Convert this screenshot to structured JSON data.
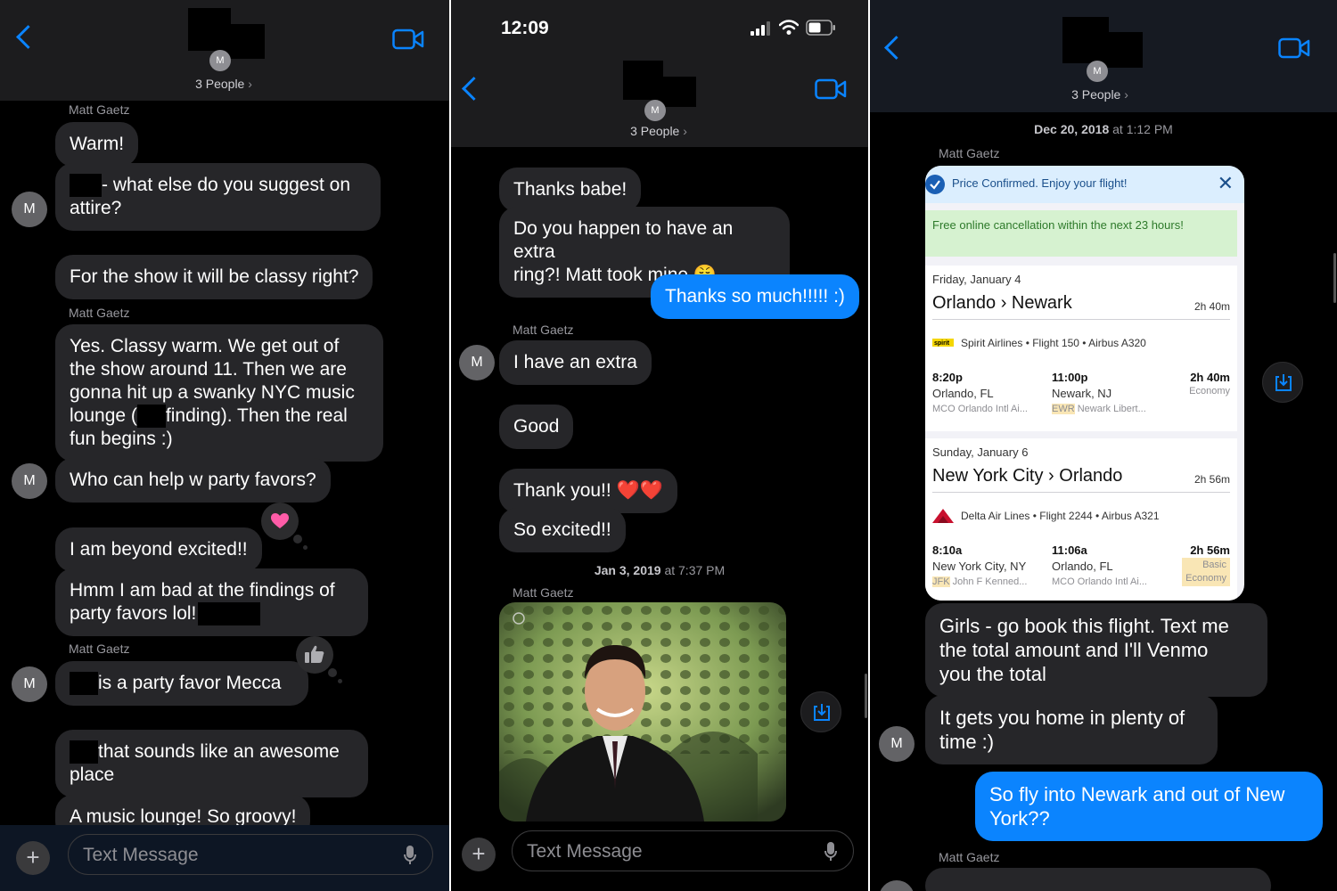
{
  "panel1": {
    "header": {
      "avatar_initial": "M",
      "group_label": "3 People",
      "chevron": "›"
    },
    "messages": [
      {
        "sender": "Matt Gaetz"
      },
      {
        "text": "Warm!"
      },
      {
        "text_after_redaction": "- what else do you suggest on",
        "text_line2": "attire?"
      },
      {
        "text": "For the show it will be classy right?"
      },
      {
        "sender": "Matt Gaetz"
      },
      {
        "lines": [
          "Yes. Classy warm. We get out of",
          "the show around 11. Then we are",
          "gonna hit up a swanky NYC music"
        ],
        "line4_before": "lounge (",
        "line4_after": "finding). Then the real",
        "line5": "fun begins :)"
      },
      {
        "text": "Who can help w party favors?"
      },
      {
        "text": "I am beyond excited!!",
        "tapback": "heart"
      },
      {
        "line1": "Hmm I am bad at the findings of",
        "line2": "party favors lol!"
      },
      {
        "sender": "Matt Gaetz"
      },
      {
        "text_after_redaction": "is a party favor Mecca",
        "tapback": "thumbs-up"
      },
      {
        "text_after_redaction": "that sounds like an awesome",
        "text_line2": "place"
      },
      {
        "text": "A music lounge! So groovy!"
      }
    ],
    "avatar_initial": "M",
    "compose": {
      "placeholder": "Text Message",
      "plus": "+"
    }
  },
  "panel2": {
    "status": {
      "time": "12:09"
    },
    "header": {
      "avatar_initial": "M",
      "group_label": "3 People",
      "chevron": "›"
    },
    "messages": [
      {
        "text": "Thanks babe!"
      },
      {
        "line1": "Do you happen to have an extra",
        "line2": "ring?! Matt took mine 😤"
      },
      {
        "text": "Thanks so much!!!!! :)"
      },
      {
        "sender": "Matt Gaetz"
      },
      {
        "text": "I have an extra"
      },
      {
        "text": "Good"
      },
      {
        "text": "Thank you!! ❤️❤️"
      },
      {
        "text": "So excited!!"
      },
      {
        "sender": "Matt Gaetz"
      }
    ],
    "timestamp": {
      "date": "Jan 3, 2019",
      "time": "at 7:37 PM"
    },
    "avatar_initial": "M",
    "compose": {
      "placeholder": "Text Message",
      "plus": "+"
    }
  },
  "panel3": {
    "header": {
      "avatar_initial": "M",
      "group_label": "3 People",
      "chevron": "›"
    },
    "timestamp": {
      "date": "Dec 20, 2018",
      "time": "at 1:12 PM"
    },
    "sender": "Matt Gaetz",
    "sender_bottom": "Matt Gaetz",
    "card": {
      "banner": "Price Confirmed. Enjoy your flight!",
      "close": "✕",
      "cancellation": "Free online cancellation within the next 23 hours!",
      "seg1": {
        "date": "Friday, January 4",
        "route": "Orlando › Newark",
        "duration": "2h 40m",
        "airline_logo": "spirit",
        "airline": "Spirit Airlines • Flight 150 • Airbus A320",
        "depart_time": "8:20p",
        "depart_city": "Orlando, FL",
        "depart_airport": "MCO Orlando Intl Ai...",
        "arrive_time": "11:00p",
        "arrive_city": "Newark, NJ",
        "arrive_code": "EWR",
        "arrive_airport": "Newark Libert...",
        "total": "2h 40m",
        "class": "Economy"
      },
      "seg2": {
        "date": "Sunday, January 6",
        "route": "New York City › Orlando",
        "duration": "2h 56m",
        "airline": "Delta Air Lines • Flight 2244 • Airbus A321",
        "depart_time": "8:10a",
        "depart_city": "New York City, NY",
        "depart_code": "JFK",
        "depart_airport": "John F Kenned...",
        "arrive_time": "11:06a",
        "arrive_city": "Orlando, FL",
        "arrive_airport": "MCO Orlando Intl Ai...",
        "total": "2h 56m",
        "class_line1": "Basic",
        "class_line2": "Economy"
      }
    },
    "messages": [
      {
        "lines": [
          "Girls - go book this flight. Text me",
          "the total amount and I'll Venmo",
          "you the total"
        ]
      },
      {
        "line1": "It gets you home in plenty of",
        "line2": "time :)"
      },
      {
        "line1": "So fly into Newark and out of New",
        "line2": "York??"
      }
    ],
    "avatar_initial": "M"
  },
  "colors": {
    "bubble_in": "#262629",
    "bubble_out": "#0b84fe",
    "accent": "#0a84ff"
  }
}
